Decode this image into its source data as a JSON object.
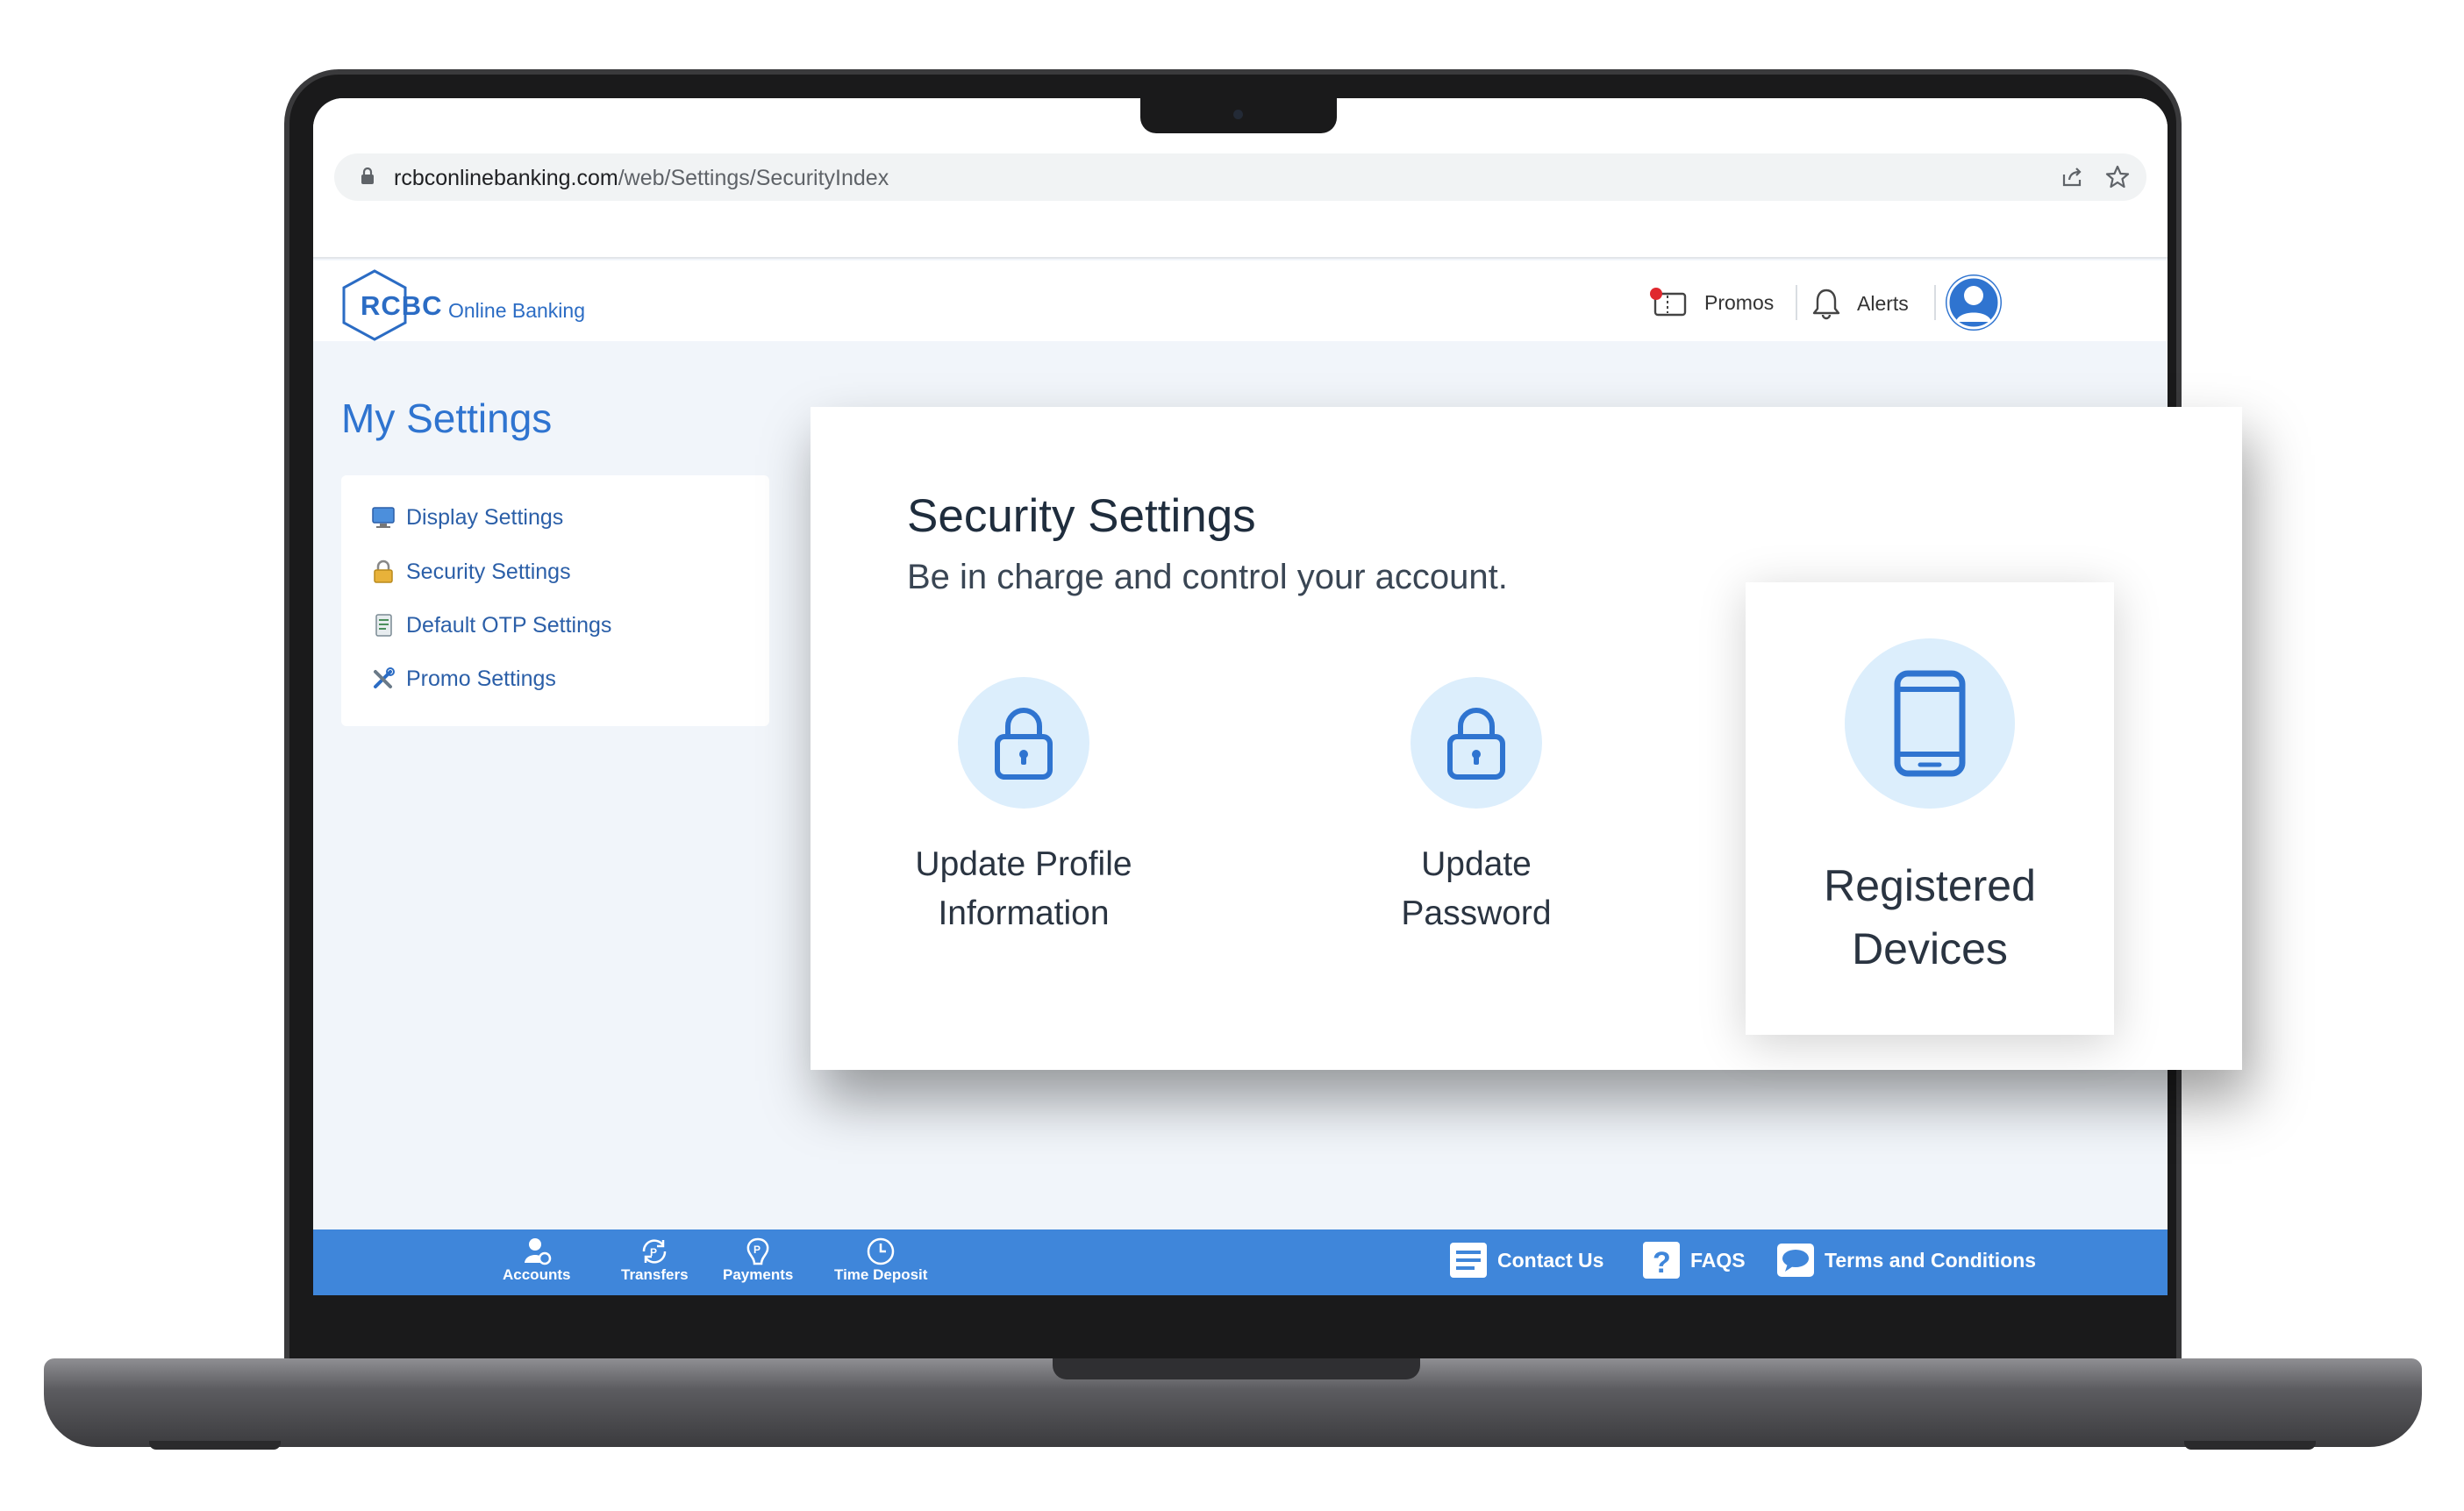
{
  "browser": {
    "url_domain": "rcbconlinebanking.com",
    "url_path": "/web/Settings/SecurityIndex"
  },
  "header": {
    "logo_text": "RCBC",
    "logo_sub": "Online Banking",
    "promos_label": "Promos",
    "alerts_label": "Alerts"
  },
  "sidebar": {
    "title": "My Settings",
    "items": [
      {
        "label": "Display Settings",
        "icon": "monitor-icon"
      },
      {
        "label": "Security Settings",
        "icon": "padlock-icon"
      },
      {
        "label": "Default OTP Settings",
        "icon": "document-icon"
      },
      {
        "label": "Promo Settings",
        "icon": "tools-icon"
      }
    ]
  },
  "security": {
    "title": "Security Settings",
    "subtitle": "Be in charge and control your account.",
    "options": [
      {
        "line1": "Update Profile",
        "line2": "Information",
        "icon": "lock-icon"
      },
      {
        "line1": "Update",
        "line2": "Password",
        "icon": "lock-icon"
      },
      {
        "line1": "Registered",
        "line2": "Devices",
        "icon": "smartphone-icon"
      }
    ]
  },
  "footer": {
    "nav": [
      {
        "label": "Accounts",
        "icon": "accounts-icon"
      },
      {
        "label": "Transfers",
        "icon": "transfers-icon"
      },
      {
        "label": "Payments",
        "icon": "payments-icon"
      },
      {
        "label": "Time Deposit",
        "icon": "clock-icon"
      }
    ],
    "links": [
      {
        "label": "Contact Us",
        "icon": "contact-icon"
      },
      {
        "label": "FAQS",
        "icon": "question-icon"
      },
      {
        "label": "Terms and Conditions",
        "icon": "chat-icon"
      }
    ]
  },
  "colors": {
    "brand_blue": "#2f74d0",
    "footer_blue": "#3f86da",
    "icon_circle": "#dceefc",
    "page_bg": "#f1f5fa"
  }
}
